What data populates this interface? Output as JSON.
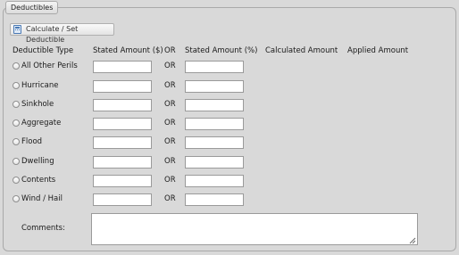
{
  "panel": {
    "legend": "Deductibles",
    "calc_button_label": "Calculate / Set Deductible"
  },
  "headers": {
    "type": "Deductible Type",
    "stated_dollar": "Stated Amount ($)",
    "or": "OR",
    "stated_percent": "Stated Amount (%)",
    "calculated": "Calculated Amount",
    "applied": "Applied Amount"
  },
  "rows": [
    {
      "label": "All Other Perils",
      "or": "OR",
      "dollar": "",
      "percent": ""
    },
    {
      "label": "Hurricane",
      "or": "OR",
      "dollar": "",
      "percent": ""
    },
    {
      "label": "Sinkhole",
      "or": "OR",
      "dollar": "",
      "percent": ""
    },
    {
      "label": "Aggregate",
      "or": "OR",
      "dollar": "",
      "percent": ""
    },
    {
      "label": "Flood",
      "or": "OR",
      "dollar": "",
      "percent": ""
    },
    {
      "label": "Dwelling",
      "or": "OR",
      "dollar": "",
      "percent": ""
    },
    {
      "label": "Contents",
      "or": "OR",
      "dollar": "",
      "percent": ""
    },
    {
      "label": "Wind / Hail",
      "or": "OR",
      "dollar": "",
      "percent": ""
    }
  ],
  "comments": {
    "label": "Comments:",
    "value": ""
  },
  "colors": {
    "background": "#d9d9d9",
    "border": "#a9a9a9",
    "field_bg": "#ffffff",
    "icon_accent": "#4a79b4"
  }
}
